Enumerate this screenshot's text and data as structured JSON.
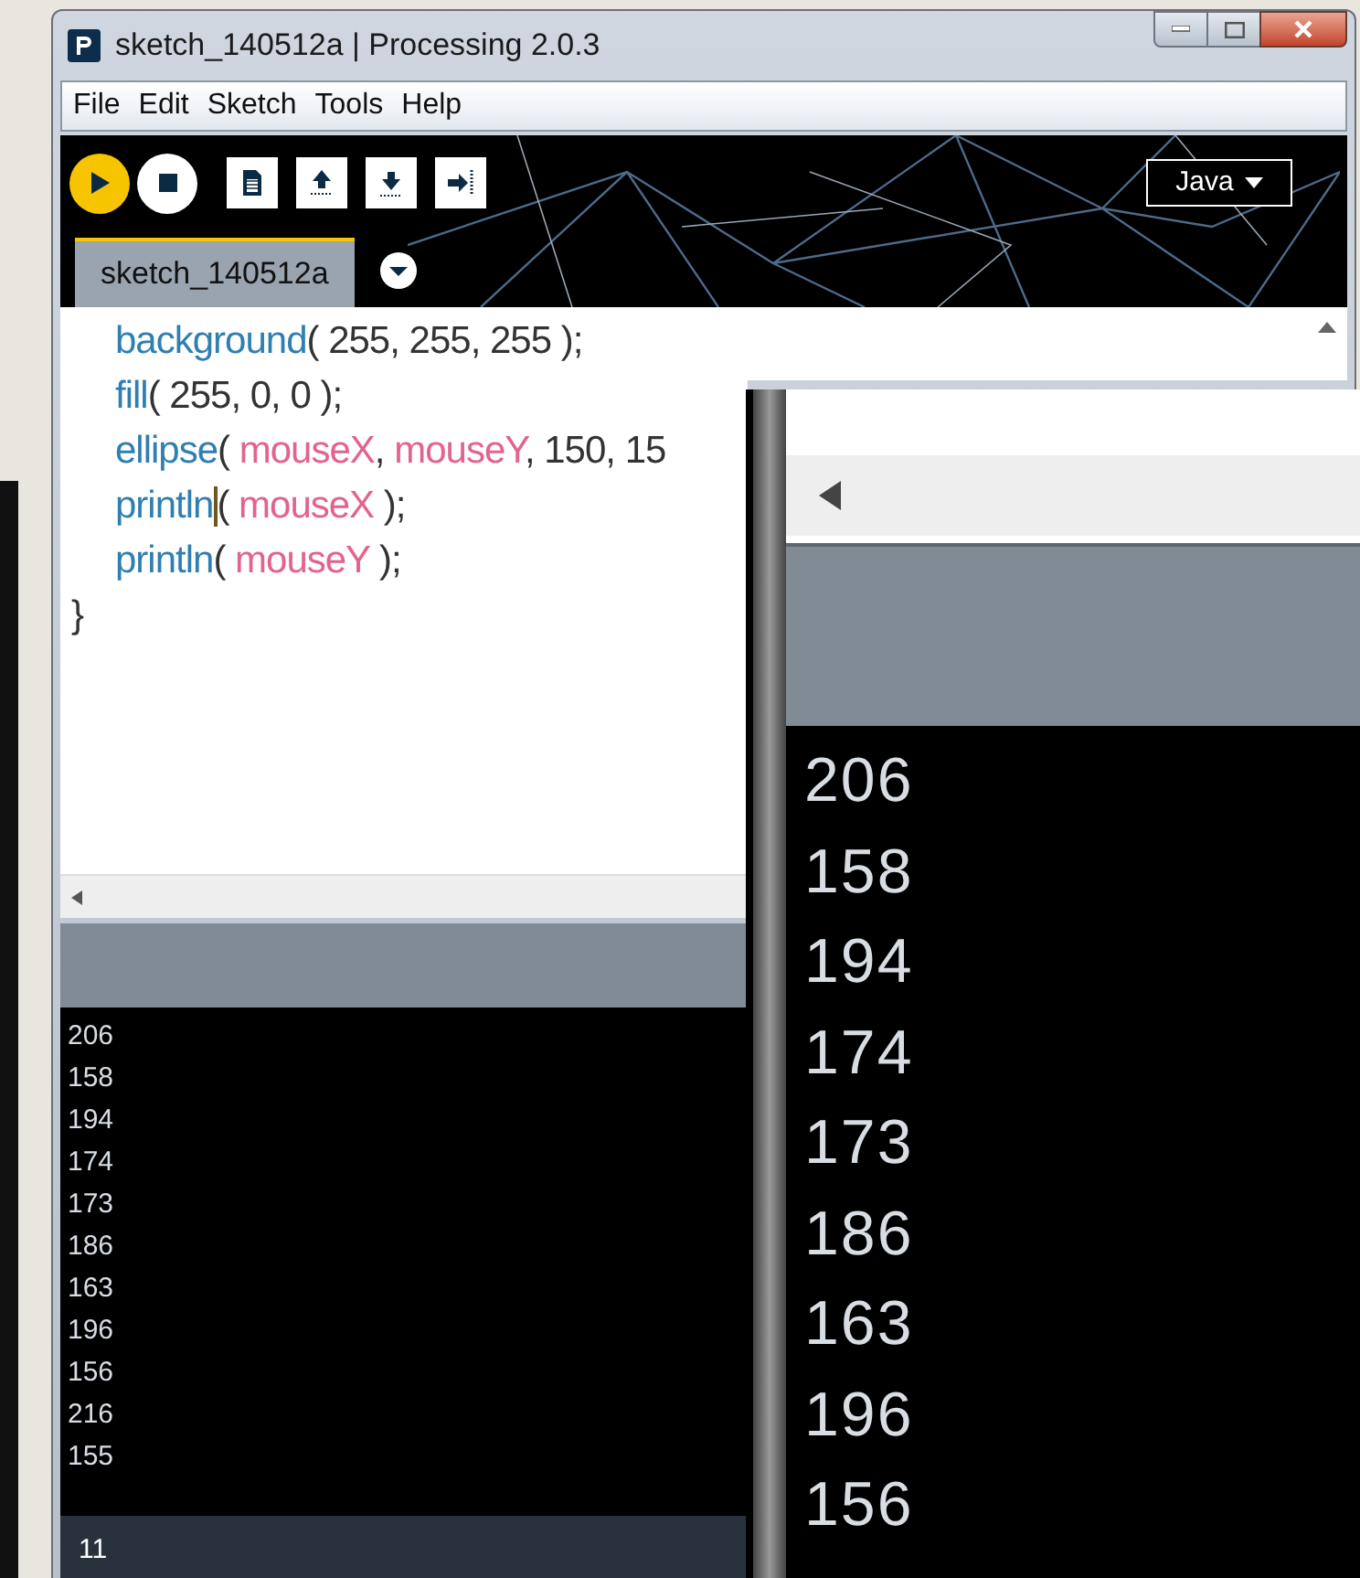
{
  "window": {
    "title": "sketch_140512a | Processing 2.0.3"
  },
  "menu": [
    "File",
    "Edit",
    "Sketch",
    "Tools",
    "Help"
  ],
  "toolbar": {
    "mode": "Java"
  },
  "tabs": [
    {
      "label": "sketch_140512a",
      "selected": true
    }
  ],
  "editor": {
    "lines": [
      {
        "indented": true,
        "segments": [
          {
            "text": "background",
            "kind": "function",
            "caret": false
          },
          {
            "text": "( 255, 255, 255 );",
            "kind": "plain",
            "caret": false
          }
        ]
      },
      {
        "indented": true,
        "segments": [
          {
            "text": "fill",
            "kind": "function",
            "caret": false
          },
          {
            "text": "( 255, 0, 0 );",
            "kind": "plain",
            "caret": false
          }
        ]
      },
      {
        "indented": true,
        "segments": [
          {
            "text": "ellipse",
            "kind": "function",
            "caret": false
          },
          {
            "text": "( ",
            "kind": "plain",
            "caret": false
          },
          {
            "text": "mouseX",
            "kind": "variable",
            "caret": false
          },
          {
            "text": ", ",
            "kind": "plain",
            "caret": false
          },
          {
            "text": "mouseY",
            "kind": "variable",
            "caret": false
          },
          {
            "text": ", 150, 15",
            "kind": "plain",
            "caret": false
          }
        ]
      },
      {
        "indented": true,
        "segments": [
          {
            "text": "println",
            "kind": "function",
            "caret": true
          },
          {
            "text": "( ",
            "kind": "plain",
            "caret": false
          },
          {
            "text": "mouseX",
            "kind": "variable",
            "caret": false
          },
          {
            "text": " );",
            "kind": "plain",
            "caret": false
          }
        ]
      },
      {
        "indented": true,
        "segments": [
          {
            "text": "println",
            "kind": "function",
            "caret": false
          },
          {
            "text": "( ",
            "kind": "plain",
            "caret": false
          },
          {
            "text": "mouseY",
            "kind": "variable",
            "caret": false
          },
          {
            "text": " );",
            "kind": "plain",
            "caret": false
          }
        ]
      },
      {
        "indented": false,
        "segments": [
          {
            "text": "}",
            "kind": "plain",
            "caret": false
          }
        ]
      }
    ]
  },
  "console": {
    "lines": [
      "206",
      "158",
      "194",
      "174",
      "173",
      "186",
      "163",
      "196",
      "156",
      "216",
      "155"
    ]
  },
  "status_bar": {
    "line_number": "11"
  },
  "magnifier": {
    "console_lines": [
      "206",
      "158",
      "194",
      "174",
      "173",
      "186",
      "163",
      "196",
      "156"
    ]
  }
}
